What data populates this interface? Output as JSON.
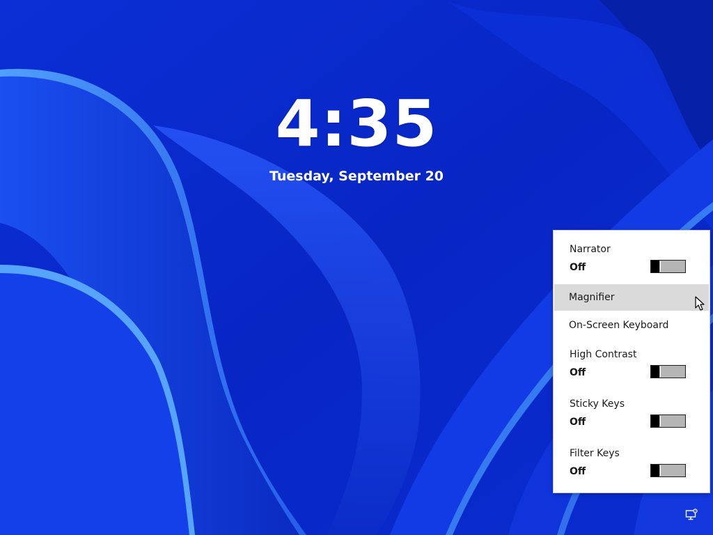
{
  "lock_screen": {
    "time": "4:35",
    "date": "Tuesday, September 20"
  },
  "ease_of_access_menu": {
    "narrator": {
      "label": "Narrator",
      "state": "Off",
      "on": false
    },
    "magnifier": {
      "label": "Magnifier"
    },
    "on_screen_keyboard": {
      "label": "On-Screen Keyboard"
    },
    "high_contrast": {
      "label": "High Contrast",
      "state": "Off",
      "on": false
    },
    "sticky_keys": {
      "label": "Sticky Keys",
      "state": "Off",
      "on": false
    },
    "filter_keys": {
      "label": "Filter Keys",
      "state": "Off",
      "on": false
    }
  },
  "icons": {
    "cursor": "mouse-pointer-icon",
    "accessibility_button": "ease-of-access-icon"
  },
  "colors": {
    "background": "#0a2bd0",
    "menu_background": "#ffffff",
    "hover_background": "#dadada"
  }
}
